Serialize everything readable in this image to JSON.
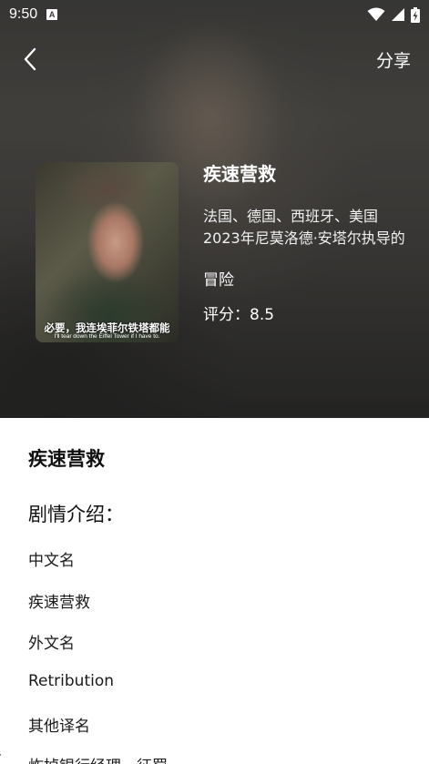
{
  "status_bar": {
    "time": "9:50",
    "notification_icon": "A",
    "icons": [
      "wifi-icon",
      "signal-icon",
      "battery-charging-icon"
    ]
  },
  "nav": {
    "back_icon": "chevron-left-icon",
    "share_label": "分享"
  },
  "movie": {
    "title": "疾速营救",
    "country": "法国、德国、西班牙、美国",
    "description": "2023年尼莫洛德·安塔尔执导的",
    "genre": "冒险",
    "rating_label": "评分：",
    "rating": "8.5",
    "poster": {
      "subtitle_cn": "必要，我连埃菲尔铁塔都能",
      "subtitle_en": "I'll tear down the Eiffel Tower if I have to."
    }
  },
  "details": {
    "title": "疾速营救",
    "section_heading": "剧情介绍：",
    "lines": [
      "中文名",
      "疾速营救",
      "外文名",
      "Retribution",
      "其他译名",
      "炸掉银行经理，征罚"
    ]
  }
}
